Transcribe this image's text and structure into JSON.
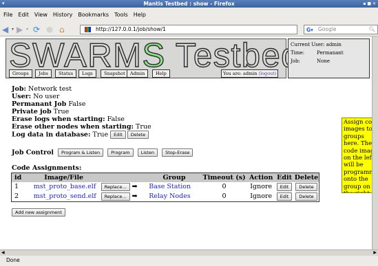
{
  "window": {
    "title": "Mantis Testbed : show - Firefox",
    "controls": "▪ ■ ✕"
  },
  "menu": [
    "File",
    "Edit",
    "View",
    "History",
    "Bookmarks",
    "Tools",
    "Help"
  ],
  "toolbar": {
    "url": "http://127.0.0.1/job/show/1",
    "search_placeholder": "Google",
    "icons": [
      "back-icon",
      "forward-icon",
      "reload-icon",
      "stop-icon",
      "home-icon"
    ]
  },
  "header": {
    "logo_prefix": "SWARM",
    "logo_accent": "S",
    "logo_suffix": " Testbed",
    "nav": [
      "Groups",
      "Jobs",
      "Status",
      "Logs",
      "Snapshot",
      "Admin",
      "Help"
    ],
    "you_are": "You are: admin",
    "logout": "(logout)"
  },
  "userinfo": {
    "current_user": "Current User: admin",
    "time_label": "Time:",
    "time_value": "Permanant",
    "job_label": "Job:",
    "job_value": "None"
  },
  "job": {
    "job_label": "Job:",
    "job_value": "Network test",
    "user_label": "User:",
    "user_value": "No user",
    "permanent_label": "Permanant Job",
    "permanent_value": "False",
    "private_label": "Private job",
    "private_value": "True",
    "erase_logs_label": "Erase logs when starting:",
    "erase_logs_value": "False",
    "erase_nodes_label": "Erase other nodes when starting:",
    "erase_nodes_value": "True",
    "log_db_label": "Log data in database:",
    "log_db_value": "True",
    "edit_label": "Edit",
    "delete_label": "Delete"
  },
  "job_control": {
    "label": "Job Control",
    "buttons": [
      "Program & Listen",
      "Program",
      "Listen",
      "Stop-Erase"
    ]
  },
  "code_assignments": {
    "title": "Code Assignments:",
    "columns": [
      "id",
      "Image/File",
      "",
      "Group",
      "Timeout (s)",
      "Action",
      "Edit",
      "Delete"
    ],
    "rows": [
      {
        "id": "1",
        "file": "mst_proto_base.elf",
        "replace": "Replace...",
        "group": "Base Station",
        "timeout": "0",
        "action": "Ignore",
        "edit": "Edit",
        "delete": "Delete"
      },
      {
        "id": "2",
        "file": "mst_proto_send.elf",
        "replace": "Replace...",
        "group": "Relay Nodes",
        "timeout": "0",
        "action": "Ignore",
        "edit": "Edit",
        "delete": "Delete"
      }
    ],
    "add_button": "Add new assignment"
  },
  "hint": "Assign code images to groups here. The code image on the left will be programmed onto the group on the right.",
  "status": "Done",
  "colors": {
    "titlebar": "#3c64a4",
    "hint_bg": "#ffff00",
    "logo_accent": "#8ee28a",
    "link": "#2222cc"
  }
}
